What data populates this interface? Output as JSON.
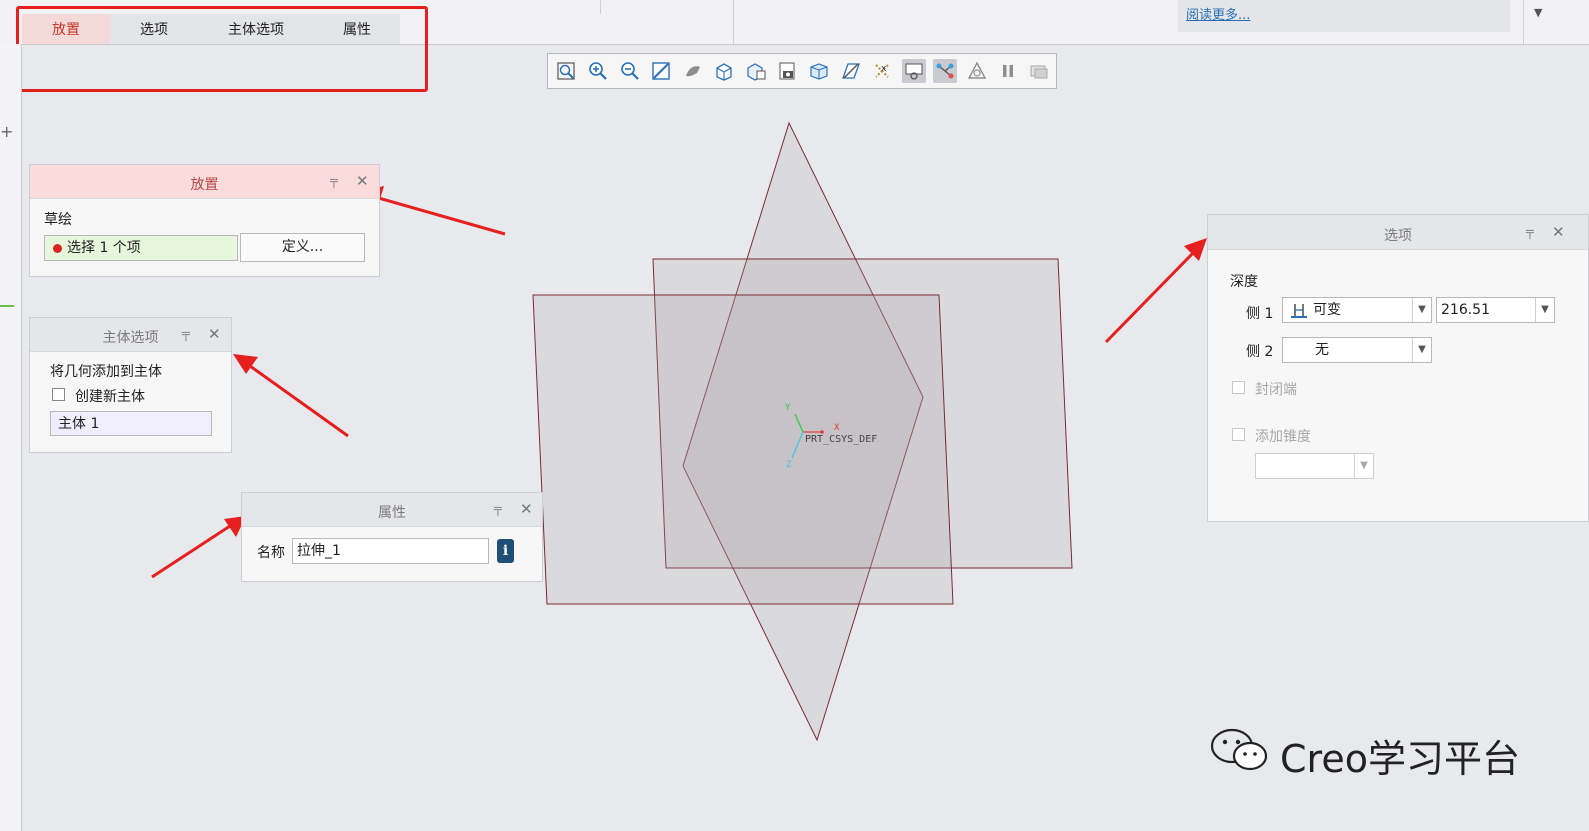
{
  "tabs": [
    {
      "label": "放置",
      "active": true
    },
    {
      "label": "选项",
      "active": false
    },
    {
      "label": "主体选项",
      "active": false
    },
    {
      "label": "属性",
      "active": false
    }
  ],
  "header": {
    "read_more": "阅读更多..."
  },
  "toolbar": {
    "icons": [
      "zoom-to-fit-icon",
      "zoom-in-icon",
      "zoom-out-icon",
      "repaint-icon",
      "display-style-icon",
      "saved-orientations-icon",
      "named-views-icon",
      "view-manager-icon",
      "perspective-icon",
      "datum-display-icon",
      "annotation-display-icon",
      "spin-center-icon",
      "feature-preview-icon",
      "verify-icon",
      "pause-icon",
      "no-preview-icon"
    ],
    "pressed": [
      11,
      12
    ]
  },
  "placement_panel": {
    "title": "放置",
    "sketch_label": "草绘",
    "selection_text": "选择 1 个项",
    "define_button": "定义..."
  },
  "body_options_panel": {
    "title": "主体选项",
    "add_geometry_label": "将几何添加到主体",
    "create_new_body_label": "创建新主体",
    "body_value": "主体 1"
  },
  "properties_panel": {
    "title": "属性",
    "name_label": "名称",
    "name_value": "拉伸_1"
  },
  "options_panel": {
    "title": "选项",
    "depth_label": "深度",
    "side1_label": "侧 1",
    "side1_type": "可变",
    "side1_value": "216.51",
    "side2_label": "侧 2",
    "side2_type": "无",
    "capped_ends_label": "封闭端",
    "add_taper_label": "添加锥度"
  },
  "viewport": {
    "csys_label": "PRT_CSYS_DEF",
    "axis_x": "X",
    "axis_y": "Y",
    "axis_z": "Z"
  },
  "watermark": {
    "text": "Creo学习平台"
  },
  "colors": {
    "highlight": "#e5201f",
    "panel_active": "#fbdcdc",
    "datum_plane_edge": "#7a2c35"
  }
}
